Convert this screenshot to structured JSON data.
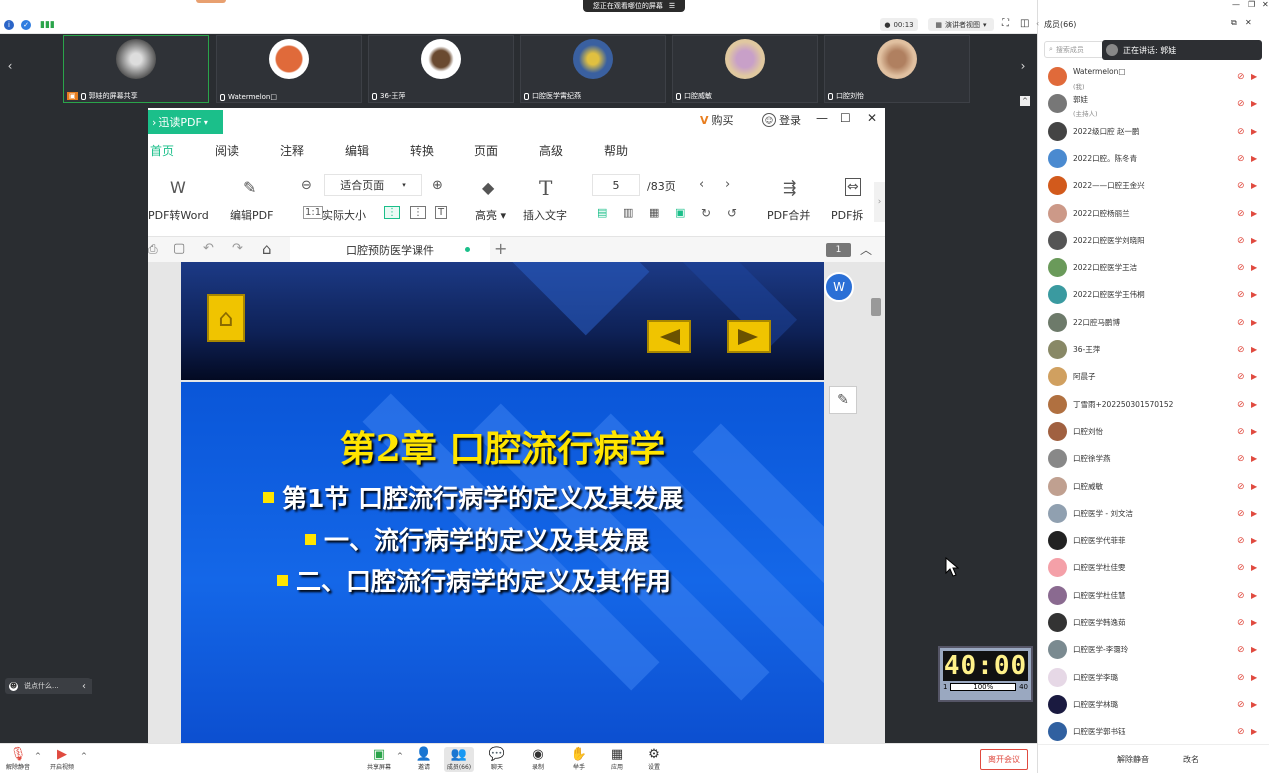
{
  "topbar": {
    "sharing_text": "您正在观看哪位的屏幕",
    "timer": "00:13",
    "view_mode": "演讲者视图"
  },
  "strip": {
    "tiles": [
      {
        "name": "郭娃的屏幕共享"
      },
      {
        "name": "Watermelon□"
      },
      {
        "name": "36-王萍"
      },
      {
        "name": "口腔医学霄纪燕"
      },
      {
        "name": "口腔威敏"
      },
      {
        "name": "口腔刘怡"
      }
    ]
  },
  "chat_hint": "说点什么...",
  "pdf": {
    "brand": "迅读PDF",
    "buy": "购买",
    "login": "登录",
    "menu": [
      "首页",
      "阅读",
      "注释",
      "编辑",
      "转换",
      "页面",
      "高级",
      "帮助"
    ],
    "ribbon": {
      "pdf_to_word": "PDF转Word",
      "edit_pdf": "编辑PDF",
      "fit_page": "适合页面",
      "actual_size": "实际大小",
      "highlight": "高亮",
      "insert_text": "插入文字",
      "page_current": "5",
      "page_total": "/83页",
      "pdf_merge": "PDF合并",
      "pdf_split": "PDF拆"
    },
    "doc_tab": "口腔预防医学课件",
    "page_badge": "1"
  },
  "slide": {
    "chapter": "第2章   口腔流行病学",
    "bullet1": "第1节  口腔流行病学的定义及其发展",
    "bullet2": "一、流行病学的定义及其发展",
    "bullet3": "二、口腔流行病学的定义及其作用"
  },
  "countdown": {
    "digits": "40:00",
    "left_label": "1",
    "percent": "100%",
    "right_label": "40"
  },
  "bottombar": {
    "mute": "解除静音",
    "video": "开启视频",
    "share": "共享屏幕",
    "invite": "邀请",
    "members": "成员(66)",
    "chat": "聊天",
    "record": "录制",
    "hand": "举手",
    "apps": "应用",
    "settings": "设置",
    "leave": "离开会议"
  },
  "panel": {
    "title": "成员(66)",
    "search_placeholder": "搜索成员",
    "speaking": "正在讲话: 郭娃",
    "members": [
      {
        "name": "Watermelon□",
        "sub": "(我)",
        "color": "#e06a3a"
      },
      {
        "name": "郭娃",
        "sub": "(主持人)",
        "color": "#777"
      },
      {
        "name": "2022级口腔 赵一鹏",
        "sub": "",
        "color": "#444"
      },
      {
        "name": "2022口腔。陈冬青",
        "sub": "",
        "color": "#4a8ad0"
      },
      {
        "name": "2022——口腔王金兴",
        "sub": "",
        "color": "#d25a1c"
      },
      {
        "name": "2022口腔杨丽兰",
        "sub": "",
        "color": "#c98"
      },
      {
        "name": "2022口腔医学刘晓阳",
        "sub": "",
        "color": "#555"
      },
      {
        "name": "2022口腔医学王洁",
        "sub": "",
        "color": "#6a9a5a"
      },
      {
        "name": "2022口腔医学王伟桐",
        "sub": "",
        "color": "#3a9aa0"
      },
      {
        "name": "22口腔马鹏博",
        "sub": "",
        "color": "#6d7a6a"
      },
      {
        "name": "36-王萍",
        "sub": "",
        "color": "#886"
      },
      {
        "name": "阿晨子",
        "sub": "",
        "color": "#d0a060"
      },
      {
        "name": "丁雪雨+202250301570152",
        "sub": "",
        "color": "#b07040"
      },
      {
        "name": "口腔刘怡",
        "sub": "",
        "color": "#a06040"
      },
      {
        "name": "口腔徐学燕",
        "sub": "",
        "color": "#888"
      },
      {
        "name": "口腔威敏",
        "sub": "",
        "color": "#c0a090"
      },
      {
        "name": "口腔医学 - 刘文洁",
        "sub": "",
        "color": "#90a0b0"
      },
      {
        "name": "口腔医学代菲菲",
        "sub": "",
        "color": "#222"
      },
      {
        "name": "口腔医学杜佳雯",
        "sub": "",
        "color": "#f4a0a8"
      },
      {
        "name": "口腔医学杜佳慧",
        "sub": "",
        "color": "#8a6a90"
      },
      {
        "name": "口腔医学韩逸茹",
        "sub": "",
        "color": "#333"
      },
      {
        "name": "口腔医学-李霭玲",
        "sub": "",
        "color": "#7a8a90"
      },
      {
        "name": "口腔医学李璐",
        "sub": "",
        "color": "#e6d8e6"
      },
      {
        "name": "口腔医学林璐",
        "sub": "",
        "color": "#1a1a40"
      },
      {
        "name": "口腔医学郭书钰",
        "sub": "",
        "color": "#3060a0"
      }
    ],
    "unmute_all": "解除静音",
    "rename": "改名"
  }
}
